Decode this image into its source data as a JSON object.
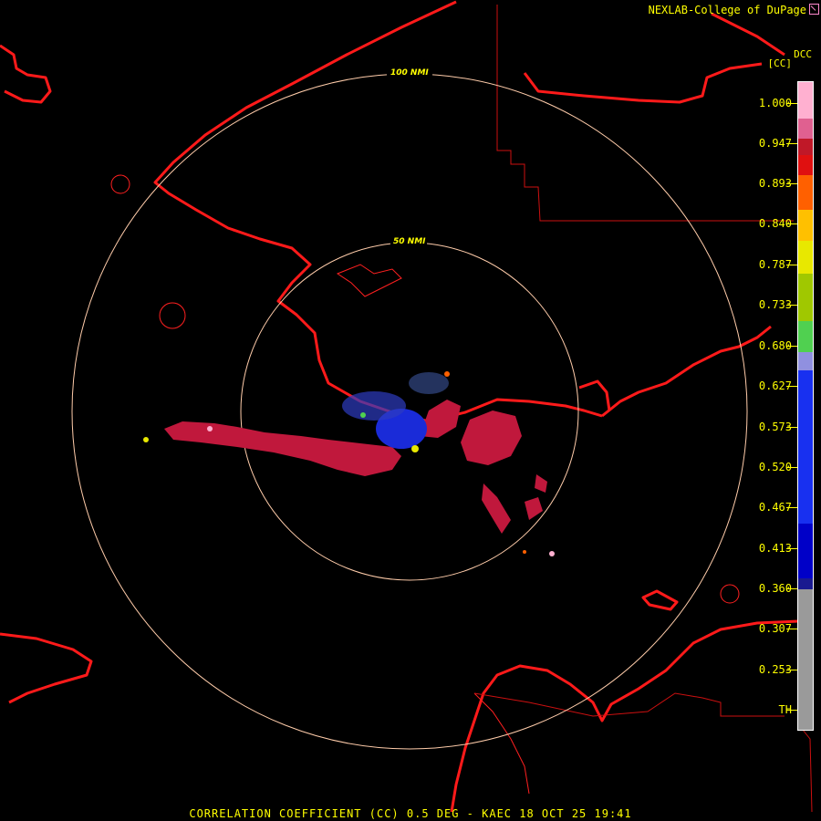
{
  "credit": "NEXLAB-College of DuPage",
  "legend": {
    "product_code": "DCC",
    "unit": "[CC]",
    "labels": [
      "1.000",
      "0.947",
      "0.893",
      "0.840",
      "0.787",
      "0.733",
      "0.680",
      "0.627",
      "0.573",
      "0.520",
      "0.467",
      "0.413",
      "0.360",
      "0.307",
      "0.253",
      "TH"
    ],
    "scale_colors": [
      "#ffb0d0",
      "#e06090",
      "#c01828",
      "#e01010",
      "#ff6000",
      "#ffc000",
      "#e8e800",
      "#a0c800",
      "#50d050",
      "#9090e0",
      "#1830f0",
      "#0000c8",
      "#1a1a90",
      "#9a9a9a"
    ]
  },
  "range_rings": [
    {
      "label": "100 NMI",
      "range_nmi": 100
    },
    {
      "label": "50 NMI",
      "range_nmi": 50
    }
  ],
  "footer": "CORRELATION COEFFICIENT (CC) 0.5 DEG - KAEC 18 OCT 25 19:41"
}
